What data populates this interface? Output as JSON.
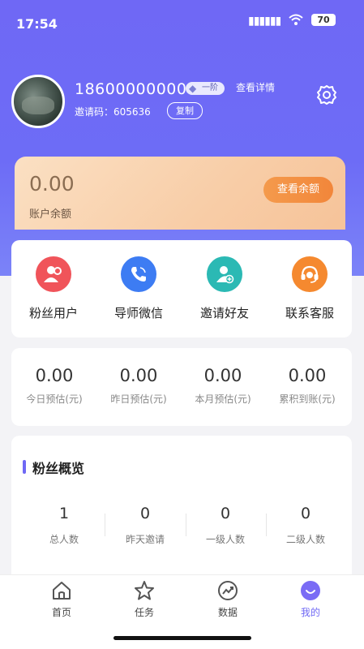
{
  "status_bar": {
    "time": "17:54",
    "battery": "70"
  },
  "profile": {
    "phone": "18600000000",
    "level": "一阶",
    "view_detail": "查看详情",
    "invite_code": "邀请码：605636",
    "copy_label": "复制"
  },
  "balance": {
    "amount": "0.00",
    "label": "账户余额",
    "view_button": "查看余额"
  },
  "menu": [
    {
      "label": "粉丝用户",
      "icon": "fans-users-icon",
      "color": "#f0545a"
    },
    {
      "label": "导师微信",
      "icon": "phone-icon",
      "color": "#3d7cf3"
    },
    {
      "label": "邀请好友",
      "icon": "add-friend-icon",
      "color": "#2bb9b4"
    },
    {
      "label": "联系客服",
      "icon": "headset-icon",
      "color": "#f5892f"
    }
  ],
  "stats": [
    {
      "value": "0.00",
      "label": "今日预估(元)"
    },
    {
      "value": "0.00",
      "label": "昨日预估(元)"
    },
    {
      "value": "0.00",
      "label": "本月预估(元)"
    },
    {
      "value": "0.00",
      "label": "累积到账(元)"
    }
  ],
  "fans_overview": {
    "title": "粉丝概览",
    "items": [
      {
        "value": "1",
        "label": "总人数"
      },
      {
        "value": "0",
        "label": "昨天邀请"
      },
      {
        "value": "0",
        "label": "一级人数"
      },
      {
        "value": "0",
        "label": "二级人数"
      }
    ]
  },
  "tabbar": [
    {
      "label": "首页",
      "icon": "home-icon"
    },
    {
      "label": "任务",
      "icon": "star-icon"
    },
    {
      "label": "数据",
      "icon": "chart-icon"
    },
    {
      "label": "我的",
      "icon": "profile-face-icon",
      "active": true
    }
  ],
  "colors": {
    "accent": "#6f68f5",
    "balance_button": "#f2863a"
  }
}
